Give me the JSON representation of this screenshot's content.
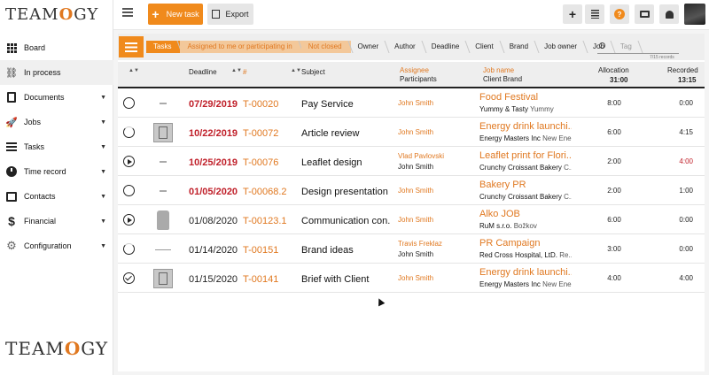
{
  "app": {
    "logo": "TEAMOGY"
  },
  "sidebar": {
    "items": [
      {
        "label": "Board",
        "icon": "grid-icon",
        "caret": false
      },
      {
        "label": "In process",
        "icon": "workflow-icon",
        "caret": false
      },
      {
        "label": "Documents",
        "icon": "document-icon",
        "caret": true
      },
      {
        "label": "Jobs",
        "icon": "rocket-icon",
        "caret": true
      },
      {
        "label": "Tasks",
        "icon": "tasks-icon",
        "caret": true
      },
      {
        "label": "Time record",
        "icon": "clock-icon",
        "caret": true
      },
      {
        "label": "Contacts",
        "icon": "contact-card-icon",
        "caret": true
      },
      {
        "label": "Financial",
        "icon": "dollar-icon",
        "caret": true
      },
      {
        "label": "Configuration",
        "icon": "gear-icon",
        "caret": true
      }
    ]
  },
  "topbar": {
    "new_task_label": "New task",
    "export_label": "Export",
    "actions": [
      "plus-icon",
      "notes-icon",
      "help-icon",
      "print-icon",
      "bell-icon"
    ],
    "help_glyph": "?"
  },
  "breadcrumbs": [
    {
      "label": "Tasks",
      "style": "first"
    },
    {
      "label": "Assigned to me or participating in",
      "style": "orange"
    },
    {
      "label": "Not closed",
      "style": "orange"
    },
    {
      "label": "Owner",
      "style": "normal"
    },
    {
      "label": "Author",
      "style": "normal"
    },
    {
      "label": "Deadline",
      "style": "normal"
    },
    {
      "label": "Client",
      "style": "normal"
    },
    {
      "label": "Brand",
      "style": "normal"
    },
    {
      "label": "Job owner",
      "style": "normal"
    },
    {
      "label": "Job",
      "style": "normal"
    },
    {
      "label": "Tag",
      "style": "gray"
    }
  ],
  "search": {
    "placeholder": "",
    "value": ""
  },
  "records_text": "7/15 records",
  "table": {
    "headers": {
      "deadline": "Deadline",
      "id": "#",
      "subject": "Subject",
      "assignee": "Assignee",
      "participants": "Participants",
      "job_name": "Job name",
      "client_brand": "Client Brand",
      "allocation": "Allocation",
      "allocation_total": "31:00",
      "recorded": "Recorded",
      "recorded_total": "13:15"
    },
    "rows": [
      {
        "status": "open",
        "thumb": "sm",
        "deadline": "07/29/2019",
        "overdue": true,
        "id": "T-00020",
        "subject": "Pay Service",
        "assignee": "John Smith",
        "participant": "",
        "job": "Food Festival",
        "client": "Yummy & Tasty",
        "brand": "Yummy",
        "allocation": "8:00",
        "recorded": "0:00",
        "recorded_red": false
      },
      {
        "status": "partial",
        "thumb": "box",
        "deadline": "10/22/2019",
        "overdue": true,
        "id": "T-00072",
        "subject": "Article review",
        "assignee": "John Smith",
        "participant": "",
        "job": "Energy drink launchi...",
        "client": "Energy Masters Inc",
        "brand": "New Energ...",
        "allocation": "6:00",
        "recorded": "4:15",
        "recorded_red": false
      },
      {
        "status": "play",
        "thumb": "sm",
        "deadline": "10/25/2019",
        "overdue": true,
        "id": "T-00076",
        "subject": "Leaflet design",
        "assignee": "Vlad Pavlovski",
        "participant": "John Smith",
        "job": "Leaflet print for Flori...",
        "client": "Crunchy Croissant Bakery",
        "brand": "C...",
        "allocation": "2:00",
        "recorded": "4:00",
        "recorded_red": true
      },
      {
        "status": "open",
        "thumb": "sm",
        "deadline": "01/05/2020",
        "overdue": true,
        "id": "T-00068.2",
        "subject": "Design presentation",
        "assignee": "John Smith",
        "participant": "",
        "job": "Bakery PR",
        "client": "Crunchy Croissant Bakery",
        "brand": "C...",
        "allocation": "2:00",
        "recorded": "1:00",
        "recorded_red": false
      },
      {
        "status": "play",
        "thumb": "bag",
        "deadline": "01/08/2020",
        "overdue": false,
        "id": "T-00123.1",
        "subject": "Communication con...",
        "assignee": "John Smith",
        "participant": "",
        "job": "Alko JOB",
        "client": "RuM s.r.o.",
        "brand": "Božkov",
        "allocation": "6:00",
        "recorded": "0:00",
        "recorded_red": false
      },
      {
        "status": "partial",
        "thumb": "line",
        "deadline": "01/14/2020",
        "overdue": false,
        "id": "T-00151",
        "subject": "Brand ideas",
        "assignee": "Travis Freklaz",
        "participant": "John Smith",
        "job": "PR Campaign",
        "client": "Red Cross Hospital, LtD.",
        "brand": "Re...",
        "allocation": "3:00",
        "recorded": "0:00",
        "recorded_red": false
      },
      {
        "status": "done",
        "thumb": "box",
        "deadline": "01/15/2020",
        "overdue": false,
        "id": "T-00141",
        "subject": "Brief with Client",
        "assignee": "John Smith",
        "participant": "",
        "job": "Energy drink launchi...",
        "client": "Energy Masters Inc",
        "brand": "New Energ...",
        "allocation": "4:00",
        "recorded": "4:00",
        "recorded_red": false
      }
    ]
  }
}
